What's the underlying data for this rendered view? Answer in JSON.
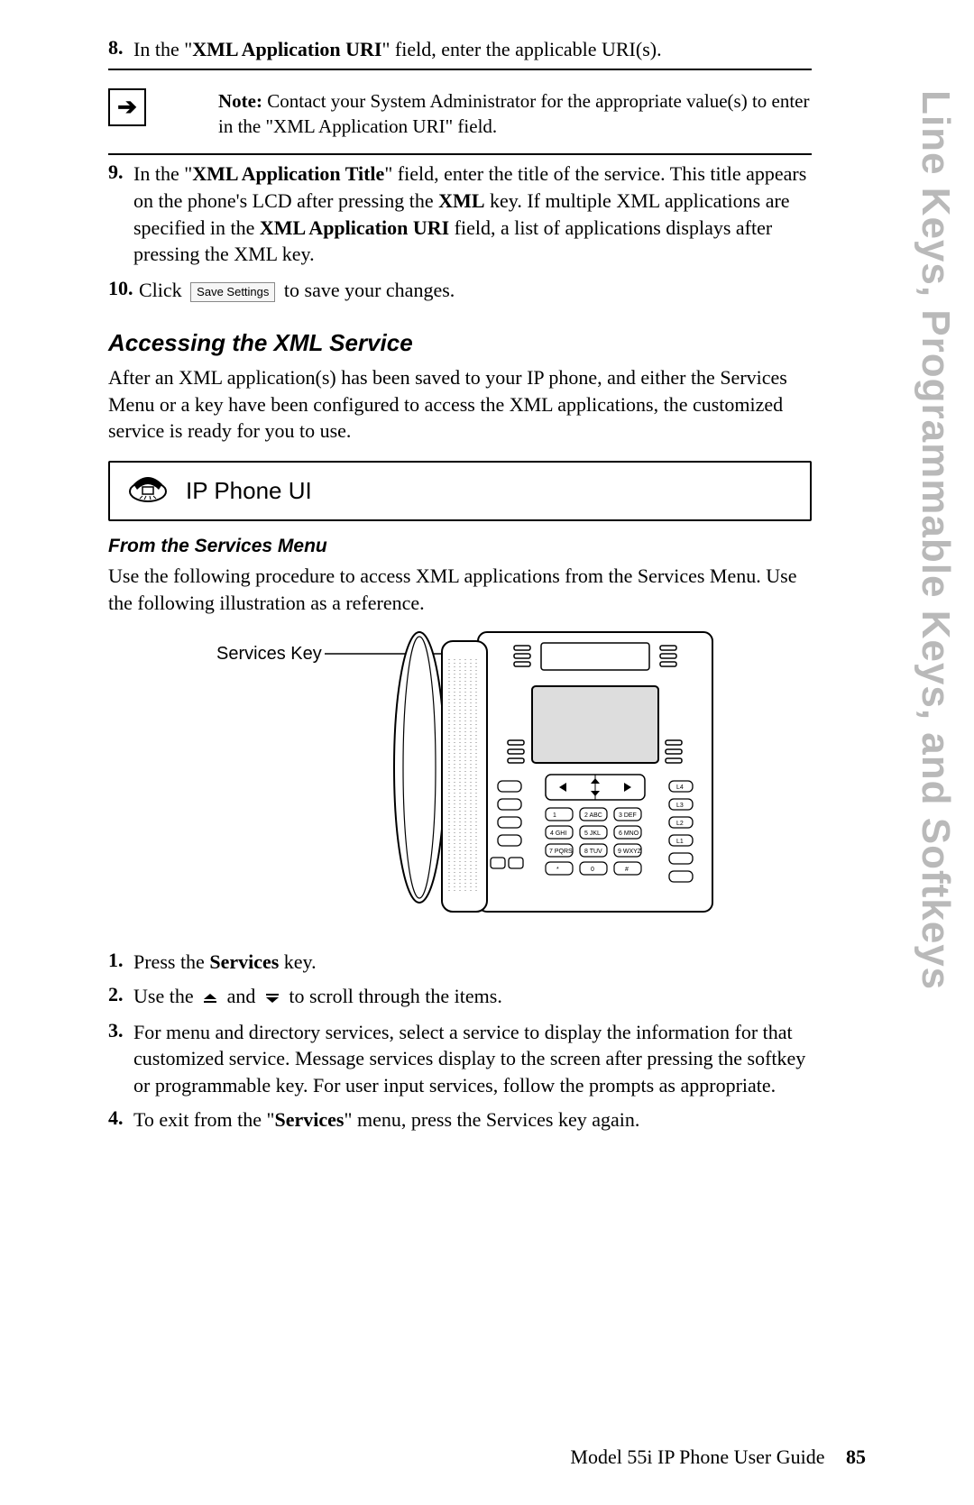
{
  "sideTitle": "Line Keys, Programmable Keys, and Softkeys",
  "steps": {
    "s8": {
      "num": "8.",
      "pre": "In the \"",
      "boldField": "XML Application URI",
      "post": "\" field, enter the applicable URI(s)."
    },
    "note": {
      "lead": "Note:",
      "text": " Contact your System Administrator for the appropriate value(s) to enter in the \"XML Application URI\" field."
    },
    "s9": {
      "num": "9.",
      "pre": "In the \"",
      "boldField": "XML Application Title",
      "mid1": "\" field, enter the title of the service. This title appears on the phone's LCD after pressing the ",
      "boldXML": "XML",
      "mid2": " key. If multiple XML applications are specified in the ",
      "boldURI": "XML Application URI",
      "post": " field, a list of applications displays after pressing the XML key."
    },
    "s10": {
      "num": "10.",
      "pre": "Click ",
      "btn": "Save Settings",
      "post": " to save your changes."
    }
  },
  "sectionTitle": "Accessing the XML Service",
  "sectionPara": "After an XML application(s) has been saved to your IP phone, and either the Services Menu or a key have been configured to access the XML applications, the customized service is ready for you to use.",
  "uiBoxLabel": "IP Phone UI",
  "subTitle": "From the Services Menu",
  "subPara": "Use the following procedure to access XML applications from the Services Menu. Use the following illustration as a reference.",
  "servicesKeyLabel": "Services Key",
  "proc": {
    "p1": {
      "num": "1.",
      "pre": "Press the ",
      "bold": "Services",
      "post": " key."
    },
    "p2": {
      "num": "2.",
      "pre": "Use the ",
      "mid": " and ",
      "post": " to scroll through the items."
    },
    "p3": {
      "num": "3.",
      "text": "For menu and directory services, select a service to display the information for that customized service. Message services display to the screen after pressing the softkey or programmable key. For user input services, follow the prompts as appropriate."
    },
    "p4": {
      "num": "4.",
      "pre": "To exit from the \"",
      "bold": "Services",
      "post": "\" menu, press the Services key again."
    }
  },
  "footer": {
    "text": "Model 55i IP Phone User Guide",
    "page": "85"
  }
}
